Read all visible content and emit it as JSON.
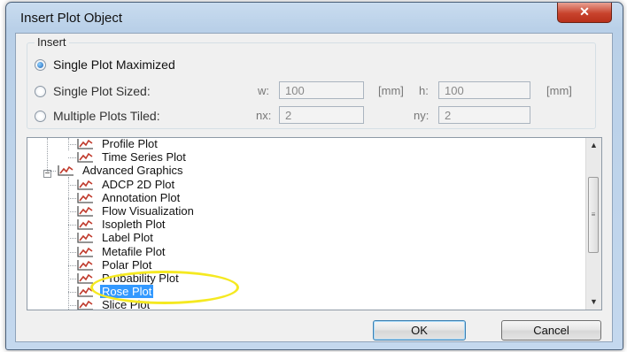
{
  "window": {
    "title": "Insert Plot Object",
    "close_label": "✕"
  },
  "insert_group": {
    "label": "Insert",
    "options": [
      {
        "label": "Single Plot Maximized",
        "checked": true
      },
      {
        "label": "Single Plot Sized:",
        "checked": false
      },
      {
        "label": "Multiple Plots Tiled:",
        "checked": false
      }
    ],
    "sized": {
      "w_label": "w:",
      "w_value": "100",
      "w_unit": "[mm]",
      "h_label": "h:",
      "h_value": "100",
      "h_unit": "[mm]"
    },
    "tiled": {
      "nx_label": "nx:",
      "nx_value": "2",
      "ny_label": "ny:",
      "ny_value": "2"
    }
  },
  "tree": {
    "expander_label": "−",
    "items": [
      {
        "label": "Profile Plot",
        "icon": "plot-icon"
      },
      {
        "label": "Time Series Plot",
        "icon": "plot-icon"
      },
      {
        "label": "Advanced Graphics",
        "icon": "folder-plot-icon",
        "expanded": true
      },
      {
        "label": "ADCP 2D Plot",
        "icon": "plot-icon"
      },
      {
        "label": "Annotation Plot",
        "icon": "plot-icon"
      },
      {
        "label": "Flow Visualization",
        "icon": "plot-icon"
      },
      {
        "label": "Isopleth Plot",
        "icon": "plot-icon"
      },
      {
        "label": "Label Plot",
        "icon": "plot-icon"
      },
      {
        "label": "Metafile Plot",
        "icon": "plot-icon"
      },
      {
        "label": "Polar Plot",
        "icon": "plot-icon"
      },
      {
        "label": "Probability Plot",
        "icon": "plot-icon"
      },
      {
        "label": "Rose Plot",
        "icon": "plot-icon",
        "selected": true
      },
      {
        "label": "Slice Plot",
        "icon": "plot-icon"
      }
    ]
  },
  "scrollbar": {
    "up": "▲",
    "down": "▼",
    "grip": "≡"
  },
  "buttons": {
    "ok": "OK",
    "cancel": "Cancel"
  },
  "colors": {
    "selection": "#3399ff",
    "annotation_ellipse": "#f5e921"
  }
}
